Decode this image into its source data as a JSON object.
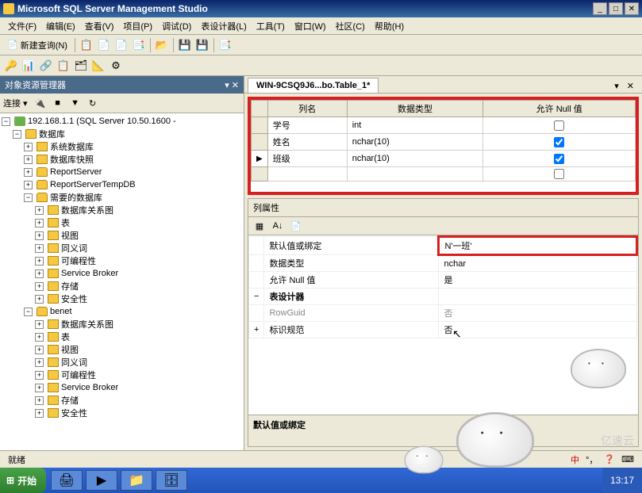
{
  "window": {
    "title": "Microsoft SQL Server Management Studio"
  },
  "menu": {
    "items": [
      "文件(F)",
      "编辑(E)",
      "查看(V)",
      "项目(P)",
      "调试(D)",
      "表设计器(L)",
      "工具(T)",
      "窗口(W)",
      "社区(C)",
      "帮助(H)"
    ]
  },
  "toolbar1": {
    "new_query": "新建查询(N)"
  },
  "explorer": {
    "title": "对象资源管理器",
    "connect_label": "连接 ▾",
    "root": "192.168.1.1 (SQL Server 10.50.1600 -",
    "nodes": {
      "databases": "数据库",
      "sys_db": "系统数据库",
      "snapshot": "数据库快照",
      "reportserver": "ReportServer",
      "reportservertemp": "ReportServerTempDB",
      "needed_db": "需要的数据库",
      "db_diagram": "数据库关系图",
      "tables": "表",
      "views": "视图",
      "synonyms": "同义词",
      "programmability": "可编程性",
      "service_broker": "Service Broker",
      "storage": "存储",
      "security": "安全性",
      "benet": "benet"
    }
  },
  "tab": {
    "label": "WIN-9CSQ9J6...bo.Table_1*"
  },
  "grid": {
    "headers": {
      "col_name": "列名",
      "data_type": "数据类型",
      "allow_null": "允许 Null 值"
    },
    "rows": [
      {
        "name": "学号",
        "type": "int",
        "null": false
      },
      {
        "name": "姓名",
        "type": "nchar(10)",
        "null": true
      },
      {
        "name": "班级",
        "type": "nchar(10)",
        "null": true
      }
    ]
  },
  "props": {
    "title": "列属性",
    "rows": {
      "default_binding": {
        "label": "默认值或绑定",
        "value": "N'一班'"
      },
      "data_type": {
        "label": "数据类型",
        "value": "nchar"
      },
      "allow_null": {
        "label": "允许 Null 值",
        "value": "是"
      },
      "table_designer": {
        "label": "表设计器",
        "value": ""
      },
      "rowguid": {
        "label": "RowGuid",
        "value": "否"
      },
      "identity": {
        "label": "标识规范",
        "value": "否"
      }
    },
    "desc": "默认值或绑定"
  },
  "status": {
    "ready": "就绪",
    "ime": "中"
  },
  "taskbar": {
    "start": "开始",
    "clock": "13:17"
  },
  "watermark": "亿速云"
}
